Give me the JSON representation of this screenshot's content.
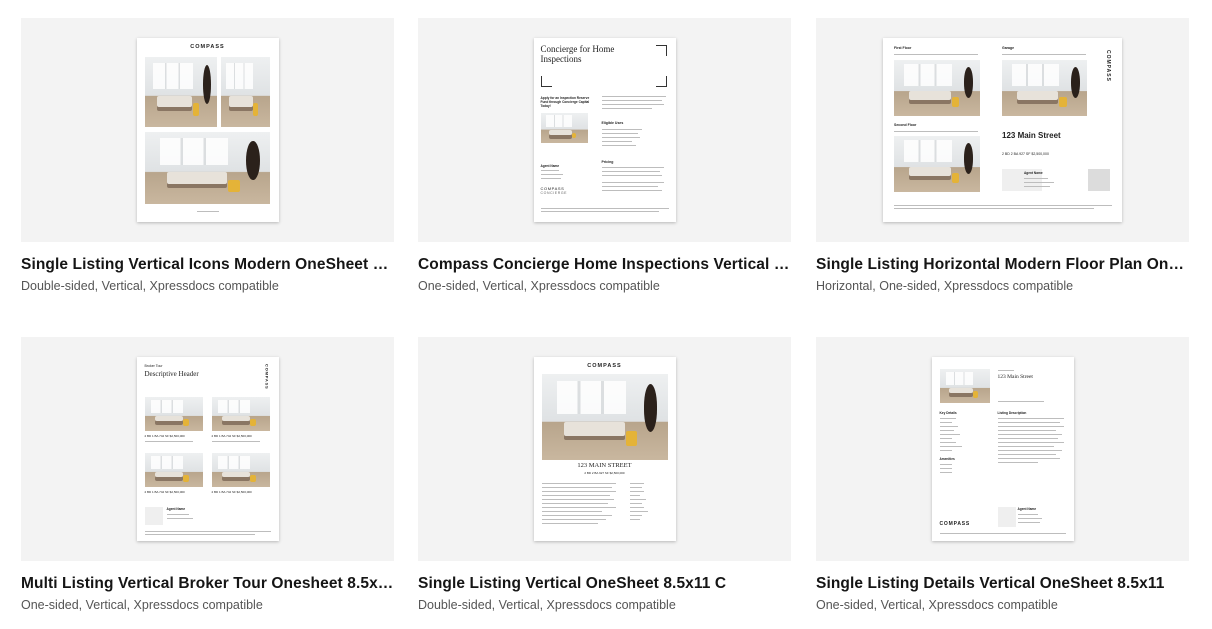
{
  "cards": [
    {
      "title": "Single Listing Vertical Icons Modern OneSheet 8.5...",
      "meta": "Double-sided, Vertical, Xpressdocs compatible",
      "preview": {
        "brand": "COMPASS"
      }
    },
    {
      "title": "Compass Concierge Home Inspections Vertical On...",
      "meta": "One-sided, Vertical, Xpressdocs compatible",
      "preview": {
        "heading": "Concierge for Home Inspections",
        "side_heading": "Apply for an Inspection Reserve Fund through Concierge Capital Today!",
        "section_a": "Eligible Uses",
        "section_b": "Pricing",
        "agent": "Agent Name",
        "brand": "COMPASS",
        "brand_sub": "CONCIERGE"
      }
    },
    {
      "title": "Single Listing Horizontal Modern Floor Plan OneSh...",
      "meta": "Horizontal, One-sided, Xpressdocs compatible",
      "preview": {
        "label_a": "First Floor",
        "label_b": "Garage",
        "label_c": "Second Floor",
        "address": "123 Main Street",
        "stats": "2 BD   2 BA   927 SF   $2,500,000",
        "agent": "Agent Name",
        "brand": "COMPASS"
      }
    },
    {
      "title": "Multi Listing Vertical Broker Tour Onesheet 8.5x11",
      "meta": "One-sided, Vertical, Xpressdocs compatible",
      "preview": {
        "eyebrow": "Broker Tour",
        "heading": "Descriptive Header",
        "brand": "COMPASS",
        "stats": "2 BD  1 BA  742 SF  $2,500,000",
        "agent": "Agent Name"
      }
    },
    {
      "title": "Single Listing Vertical OneSheet 8.5x11 C",
      "meta": "Double-sided, Vertical, Xpressdocs compatible",
      "preview": {
        "brand": "COMPASS",
        "address": "123 MAIN STREET",
        "stats": "2 BD   2 BA   927 SF   $2,500,000"
      }
    },
    {
      "title": "Single Listing Details Vertical OneSheet 8.5x11",
      "meta": "One-sided, Vertical, Xpressdocs compatible",
      "preview": {
        "address": "123 Main Street",
        "section_a": "Key Details",
        "section_b": "Listing Description",
        "section_c": "Amenities",
        "agent": "Agent Name",
        "brand": "COMPASS"
      }
    }
  ]
}
